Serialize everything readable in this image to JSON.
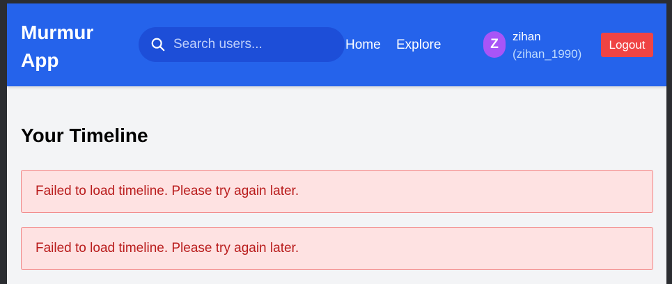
{
  "header": {
    "brand": "Murmur App",
    "search": {
      "placeholder": "Search users...",
      "value": ""
    },
    "nav": [
      {
        "label": "Home"
      },
      {
        "label": "Explore"
      }
    ],
    "user": {
      "avatar_initial": "Z",
      "name": "zihan",
      "handle": "(zihan_1990)"
    },
    "logout_label": "Logout"
  },
  "main": {
    "title": "Your Timeline",
    "alerts": [
      {
        "message": "Failed to load timeline. Please try again later."
      },
      {
        "message": "Failed to load timeline. Please try again later."
      }
    ]
  },
  "colors": {
    "navbar": "#2563eb",
    "search_bg": "#1d4ed8",
    "avatar": "#a855f7",
    "logout": "#ef4444",
    "alert_bg": "#fee2e2",
    "alert_text": "#b91c1c",
    "page_bg": "#f3f4f6"
  },
  "icons": {
    "search": "search-icon"
  }
}
